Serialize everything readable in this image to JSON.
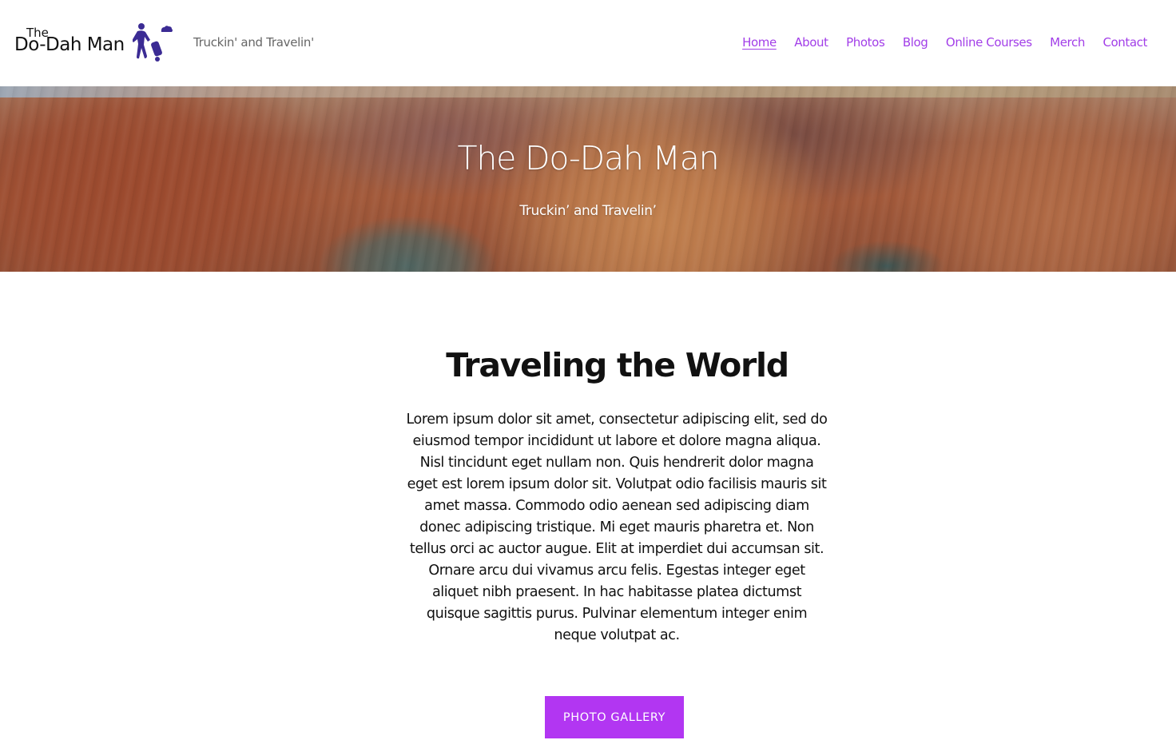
{
  "header": {
    "logo": {
      "small_text": "The",
      "main_text": "Do-Dah Man",
      "icon": "traveler-with-suitcase-icon",
      "icon_color": "#3b2b94"
    },
    "tagline": "Truckin' and Travelin'",
    "nav": {
      "items": [
        {
          "label": "Home",
          "active": true
        },
        {
          "label": "About",
          "active": false
        },
        {
          "label": "Photos",
          "active": false
        },
        {
          "label": "Blog",
          "active": false
        },
        {
          "label": "Online Courses",
          "active": false
        },
        {
          "label": "Merch",
          "active": false
        },
        {
          "label": "Contact",
          "active": false
        }
      ],
      "link_color": "#a23ee8"
    }
  },
  "hero": {
    "image": "canyon-landscape",
    "title": "The Do-Dah Man",
    "subtitle": "Truckin’ and Travelin’"
  },
  "main": {
    "heading": "Traveling the World",
    "body": "Lorem ipsum dolor sit amet, consectetur adipiscing elit, sed do eiusmod tempor incididunt ut labore et dolore magna aliqua. Nisl tincidunt eget nullam non. Quis hendrerit dolor magna eget est lorem ipsum dolor sit. Volutpat odio facilisis mauris sit amet massa. Commodo odio aenean sed adipiscing diam donec adipiscing tristique. Mi eget mauris pharetra et. Non tellus orci ac auctor augue. Elit at imperdiet dui accumsan sit. Ornare arcu dui vivamus arcu felis. Egestas integer eget aliquet nibh praesent. In hac habitasse platea dictumst quisque sagittis purus. Pulvinar elementum integer enim neque volutpat ac.",
    "cta_label": "PHOTO GALLERY",
    "cta_color": "#b236f2"
  }
}
